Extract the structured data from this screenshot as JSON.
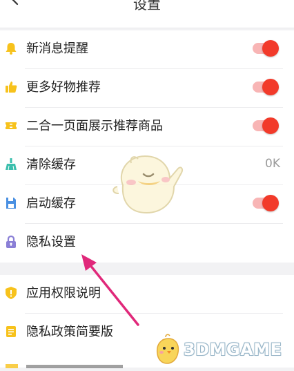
{
  "header": {
    "title": "设置"
  },
  "section1": {
    "items": [
      {
        "label": "新消息提醒",
        "icon": "bell-icon",
        "toggle": "on"
      },
      {
        "label": "更多好物推荐",
        "icon": "thumbs-up-icon",
        "toggle": "on"
      },
      {
        "label": "二合一页面展示推荐商品",
        "icon": "ticket-icon",
        "toggle": "on"
      },
      {
        "label": "清除缓存",
        "icon": "broom-icon",
        "value": "0K"
      },
      {
        "label": "启动缓存",
        "icon": "save-icon",
        "toggle": "on"
      },
      {
        "label": "隐私设置",
        "icon": "lock-icon"
      }
    ]
  },
  "section2": {
    "items": [
      {
        "label": "应用权限说明",
        "icon": "shield-icon"
      },
      {
        "label": "隐私政策简要版",
        "icon": "document-icon"
      }
    ]
  },
  "watermark": {
    "text": "3DMGAME"
  },
  "colors": {
    "toggle_on": "#f23a2a",
    "toggle_track": "#f8b5b5",
    "annotation_arrow": "#e0287a",
    "icon_yellow": "#f7c21c",
    "icon_teal": "#3bbfad",
    "icon_blue": "#4a90e2",
    "icon_purple": "#8a7fd6"
  }
}
